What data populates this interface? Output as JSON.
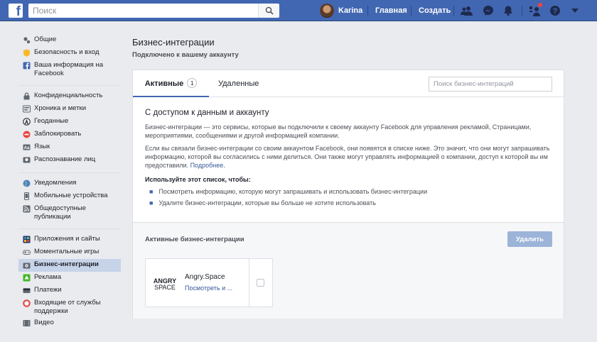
{
  "topbar": {
    "logo": "f",
    "search_placeholder": "Поиск",
    "user_name": "Karina",
    "home": "Главная",
    "create": "Создать"
  },
  "sidebar": {
    "groups": [
      [
        {
          "label": "Общие",
          "icon": "gear-icon"
        },
        {
          "label": "Безопасность и вход",
          "icon": "shield-icon"
        },
        {
          "label": "Ваша информация на Facebook",
          "icon": "facebook-icon"
        }
      ],
      [
        {
          "label": "Конфиденциальность",
          "icon": "lock-icon"
        },
        {
          "label": "Хроника и метки",
          "icon": "timeline-icon"
        },
        {
          "label": "Геоданные",
          "icon": "location-icon"
        },
        {
          "label": "Заблокировать",
          "icon": "block-icon"
        },
        {
          "label": "Язык",
          "icon": "language-icon"
        },
        {
          "label": "Распознавание лиц",
          "icon": "face-icon"
        }
      ],
      [
        {
          "label": "Уведомления",
          "icon": "globe-icon"
        },
        {
          "label": "Мобильные устройства",
          "icon": "mobile-icon"
        },
        {
          "label": "Общедоступные публикации",
          "icon": "rss-icon"
        }
      ],
      [
        {
          "label": "Приложения и сайты",
          "icon": "apps-icon"
        },
        {
          "label": "Моментальные игры",
          "icon": "gamepad-icon"
        },
        {
          "label": "Бизнес-интеграции",
          "icon": "business-icon",
          "active": true
        },
        {
          "label": "Реклама",
          "icon": "ads-icon"
        },
        {
          "label": "Платежи",
          "icon": "card-icon"
        },
        {
          "label": "Входящие от службы поддержки",
          "icon": "lifebuoy-icon"
        },
        {
          "label": "Видео",
          "icon": "video-icon"
        }
      ]
    ]
  },
  "main": {
    "title": "Бизнес-интеграции",
    "subtitle": "Подключено к вашему аккаунту",
    "tabs": {
      "active_label": "Активные",
      "active_count": "1",
      "removed_label": "Удаленные",
      "search_placeholder": "Поиск бизнес-интеграций"
    },
    "content": {
      "heading": "С доступом к данным и аккаунту",
      "p1": "Бизнес-интеграции — это сервисы, которые вы подключили к своему аккаунту Facebook для управления рекламой, Страницами, мероприятиями, сообщениями и другой информацией компании.",
      "p2": "Если вы связали бизнес-интеграции со своим аккаунтом Facebook, они появятся в списке ниже. Это значит, что они могут запрашивать информацию, которой вы согласились с ними делиться. Они также могут управлять информацией о компании, доступ к которой вы им предоставили.",
      "p2_link": "Подробнее",
      "list_title": "Используйте этот список, чтобы:",
      "bullets": [
        "Посмотреть информацию, которую могут запрашивать и использовать бизнес-интеграции",
        "Удалите бизнес-интеграции, которые вы больше не хотите использовать"
      ]
    },
    "active_section": {
      "title": "Активные бизнес-интеграции",
      "delete_label": "Удалить",
      "card": {
        "logo_top": "ANGRY",
        "logo_bottom": "SPACE",
        "name": "Angry.Space",
        "link": "Посмотреть и ..."
      }
    }
  },
  "colors": {
    "brand": "#4267b2",
    "link": "#365899",
    "active_item_bg": "#c7d3e8",
    "notification": "#fa3e3e"
  }
}
